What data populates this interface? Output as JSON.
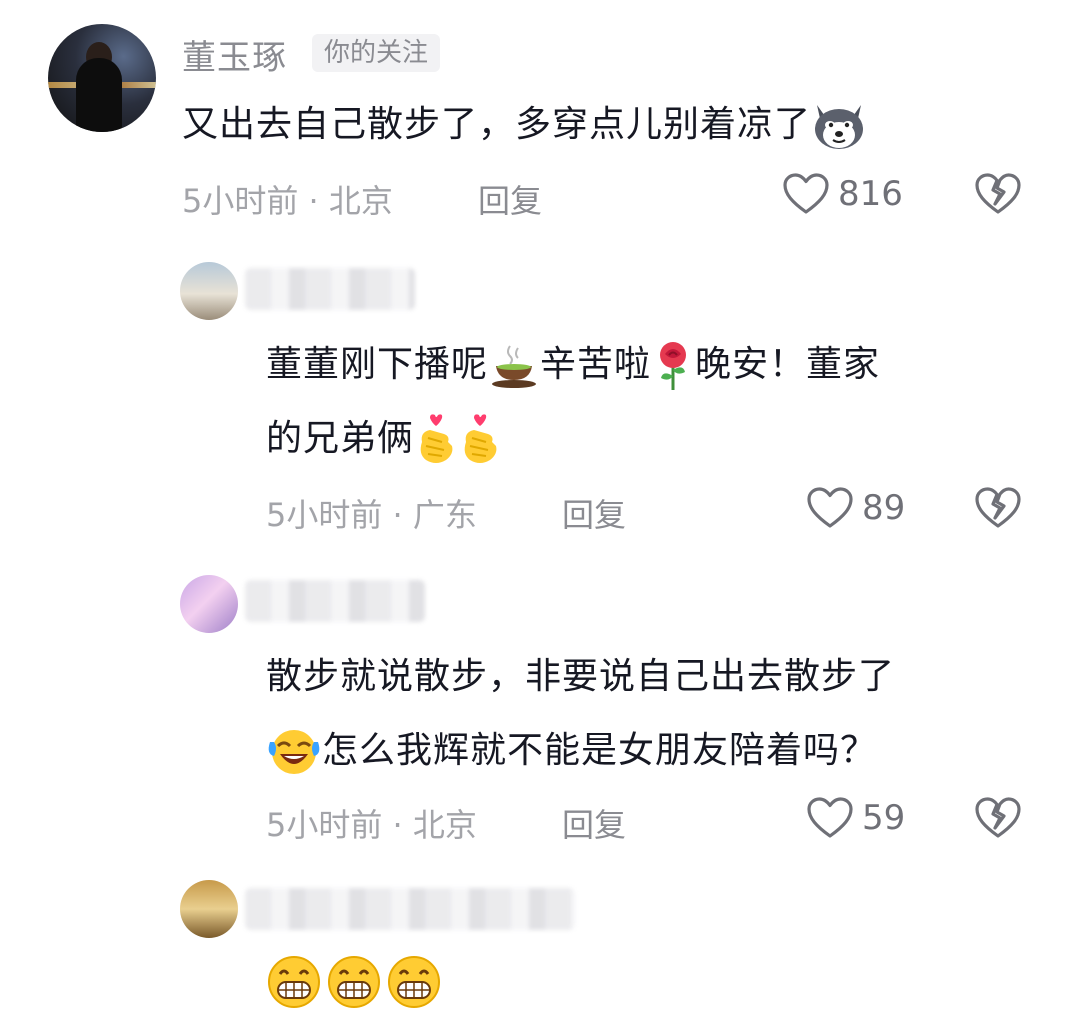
{
  "comments": [
    {
      "username": "董玉琢",
      "badge": "你的关注",
      "text": "又出去自己散步了，多穿点儿别着凉了",
      "time": "5小时前",
      "location": "北京",
      "reply_label": "回复",
      "likes": "816",
      "emoji_icons": [
        "husky-face-icon"
      ]
    },
    {
      "text_lines": [
        "董董刚下播呢",
        "辛苦啦",
        "晚安！董家",
        "的兄弟俩"
      ],
      "time": "5小时前",
      "location": "广东",
      "reply_label": "回复",
      "likes": "89",
      "emoji_icons": [
        "tea-cup-icon",
        "rose-icon",
        "finger-heart-icon",
        "finger-heart-icon"
      ]
    },
    {
      "text_lines": [
        "散步就说散步，非要说自己出去散步了",
        "怎么我辉就不能是女朋友陪着吗？"
      ],
      "time": "5小时前",
      "location": "北京",
      "reply_label": "回复",
      "likes": "59",
      "emoji_icons": [
        "laughing-crying-icon"
      ]
    },
    {
      "emoji_icons": [
        "grinning-face-icon",
        "grinning-face-icon",
        "grinning-face-icon"
      ]
    }
  ],
  "separator": "·"
}
